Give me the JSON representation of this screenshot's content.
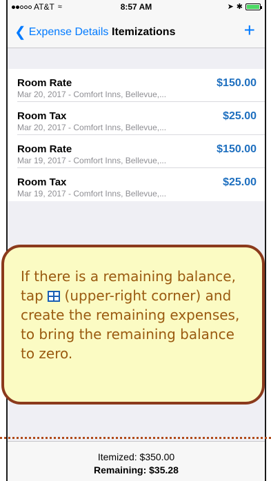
{
  "status_bar": {
    "carrier": "AT&T",
    "time": "8:57 AM"
  },
  "nav": {
    "back_label": "Expense Details",
    "title": "Itemizations",
    "add_symbol": "+"
  },
  "items": [
    {
      "title": "Room Rate",
      "subtitle": "Mar 20, 2017 - Comfort Inns, Bellevue,...",
      "amount": "$150.00"
    },
    {
      "title": "Room Tax",
      "subtitle": "Mar 20, 2017 - Comfort Inns, Bellevue,...",
      "amount": "$25.00"
    },
    {
      "title": "Room Rate",
      "subtitle": "Mar 19, 2017 - Comfort Inns, Bellevue,...",
      "amount": "$150.00"
    },
    {
      "title": "Room Tax",
      "subtitle": "Mar 19, 2017 - Comfort Inns, Bellevue,...",
      "amount": "$25.00"
    }
  ],
  "callout": {
    "text_before": "If there is a remaining balance, tap ",
    "text_after": " (upper-right corner) and create the remaining expenses, to bring the remaining balance to zero."
  },
  "footer": {
    "itemized": "Itemized: $350.00",
    "remaining": "Remaining: $35.28"
  },
  "colors": {
    "accent": "#007aff",
    "amount": "#1e6fbf",
    "callout_border": "#8b3a1c",
    "callout_bg": "#fbfbc3"
  }
}
